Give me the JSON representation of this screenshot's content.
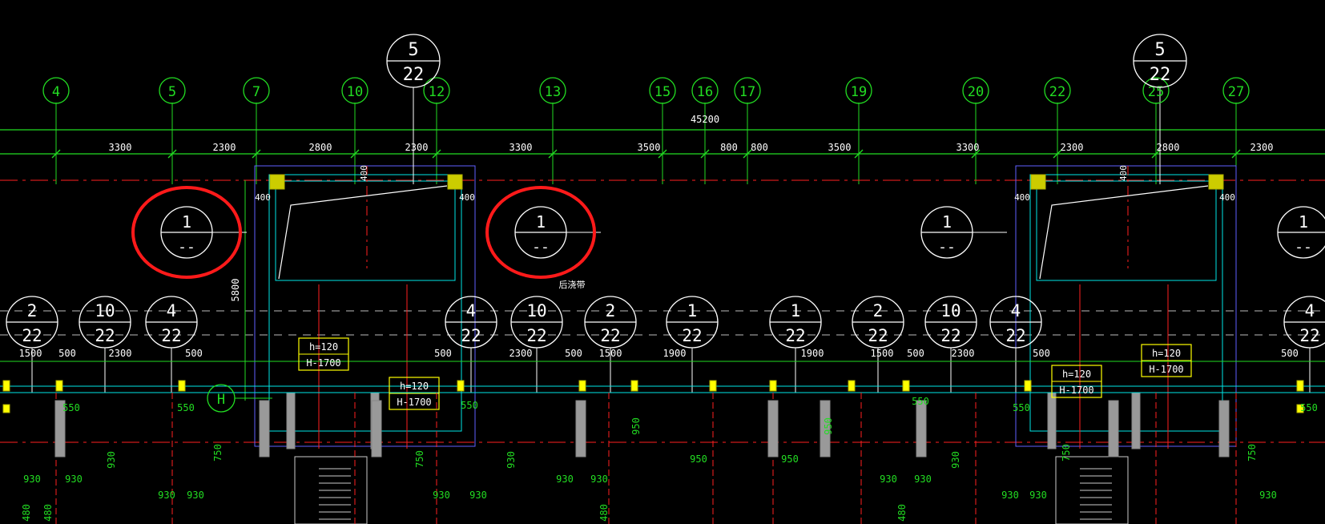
{
  "axis_labels": [
    "4",
    "5",
    "7",
    "10",
    "12",
    "13",
    "15",
    "16",
    "17",
    "19",
    "20",
    "22",
    "25",
    "27"
  ],
  "overall_dimension": "45200",
  "top_dimensions": [
    "3300",
    "2300",
    "2800",
    "2300",
    "3300",
    "3500",
    "800",
    "800",
    "3500",
    "3300",
    "2300",
    "2800",
    "2300"
  ],
  "detail_refs": {
    "five_22": {
      "top": "5",
      "bottom": "22"
    },
    "one_dash": {
      "top": "1",
      "bottom": "--"
    }
  },
  "detail_bubbles": [
    {
      "top": "2",
      "bottom": "22"
    },
    {
      "top": "10",
      "bottom": "22"
    },
    {
      "top": "4",
      "bottom": "22"
    },
    {
      "top": "4",
      "bottom": "22"
    },
    {
      "top": "10",
      "bottom": "22"
    },
    {
      "top": "2",
      "bottom": "22"
    },
    {
      "top": "1",
      "bottom": "22"
    },
    {
      "top": "1",
      "bottom": "22"
    },
    {
      "top": "2",
      "bottom": "22"
    },
    {
      "top": "10",
      "bottom": "22"
    },
    {
      "top": "4",
      "bottom": "22"
    },
    {
      "top": "4",
      "bottom": "22"
    }
  ],
  "row_axis_label": "H",
  "beam_tags": [
    {
      "h": "h=120",
      "H": "H-1700"
    },
    {
      "h": "h=120",
      "H": "H-1700"
    },
    {
      "h": "h=120",
      "H": "H-1700"
    },
    {
      "h": "h=120",
      "H": "H-1700"
    }
  ],
  "mid_dimensions": [
    "1500",
    "500",
    "2300",
    "500",
    "500",
    "2300",
    "500",
    "1500",
    "1900",
    "1900",
    "1500",
    "500",
    "2300",
    "500",
    "500"
  ],
  "small_dims": {
    "d400": "400",
    "d5800": "5800",
    "d550": "550",
    "d930": "930",
    "d750": "750",
    "d950": "950",
    "d480": "480"
  },
  "annotation": "后浇带",
  "colors": {
    "axis": "#22dd22",
    "bubble": "#ffffff",
    "dim_text": "#ffffff",
    "wall": "#00e6e6",
    "red": "#ff2020",
    "yellow": "#ffff00",
    "highlight": "#ff1a1a"
  }
}
